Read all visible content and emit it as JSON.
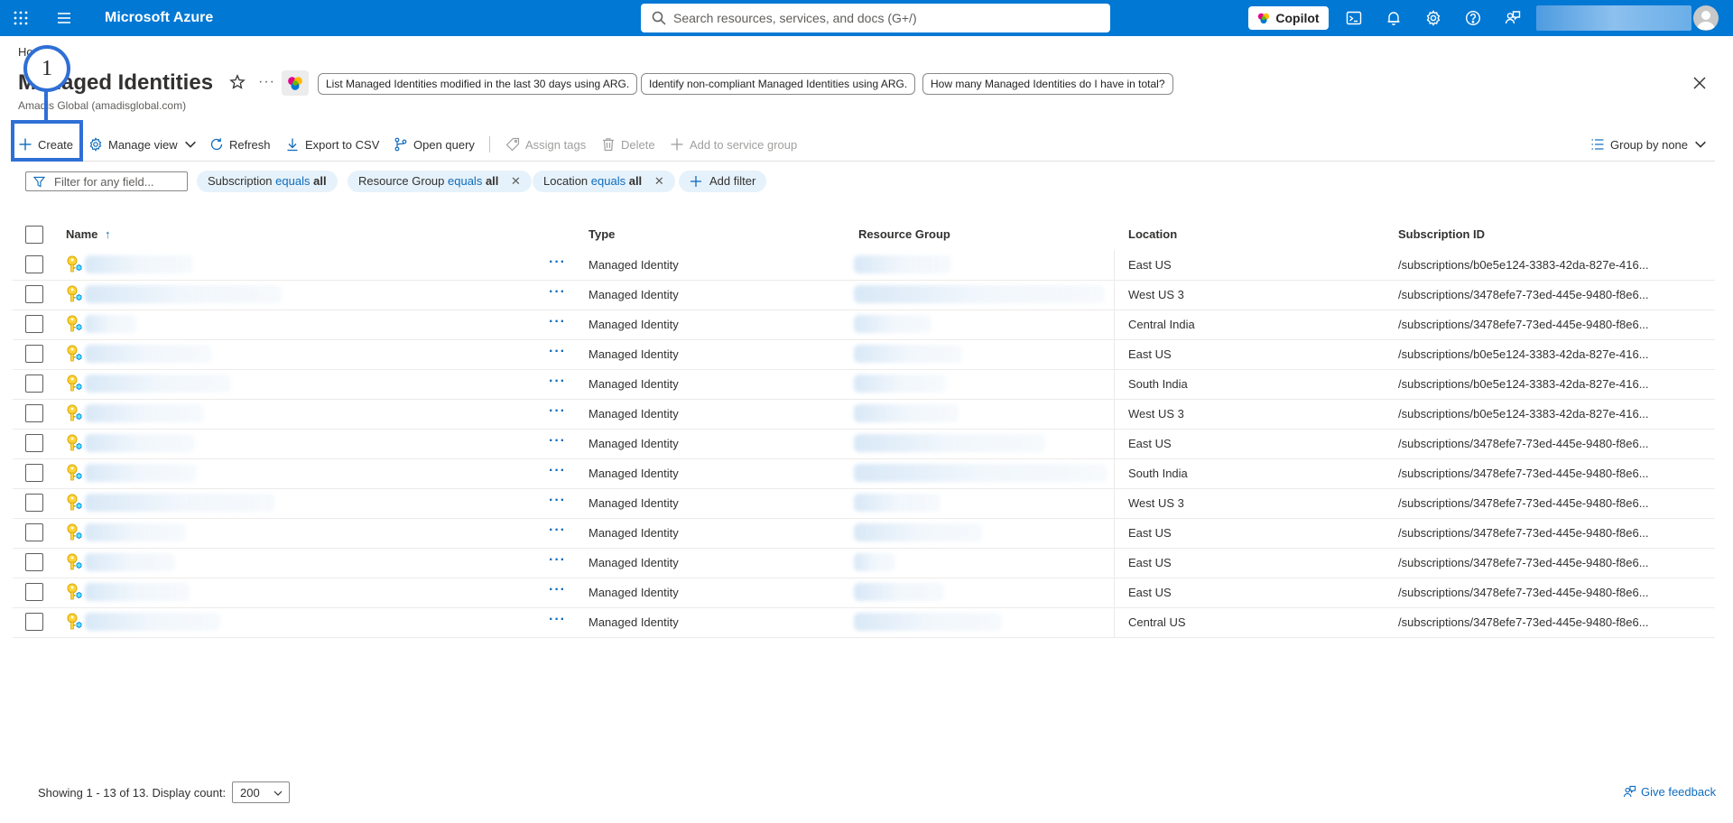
{
  "topbar": {
    "brand": "Microsoft Azure",
    "search_placeholder": "Search resources, services, and docs (G+/)",
    "copilot_label": "Copilot",
    "icons": [
      "waffle-icon",
      "menu-icon",
      "search-icon",
      "terminal-icon",
      "bell-icon",
      "gear-icon",
      "help-icon",
      "feedback-icon",
      "avatar"
    ]
  },
  "header": {
    "breadcrumb": "Ho",
    "title": "Managed Identities",
    "subtitle": "Amadis Global (amadisglobal.com)",
    "suggestions": [
      "List Managed Identities modified in the last 30 days using ARG.",
      "Identify non-compliant Managed Identities using ARG.",
      "How many Managed Identities do I have in total?"
    ]
  },
  "annotation": {
    "step": "1"
  },
  "toolbar": {
    "create": "Create",
    "manage_view": "Manage view",
    "refresh": "Refresh",
    "export_csv": "Export to CSV",
    "open_query": "Open query",
    "assign_tags": "Assign tags",
    "delete": "Delete",
    "add_service_group": "Add to service group",
    "group_by": "Group by none"
  },
  "filters": {
    "placeholder": "Filter for any field...",
    "pills": [
      {
        "field": "Subscription",
        "op": "equals",
        "value": "all"
      },
      {
        "field": "Resource Group",
        "op": "equals",
        "value": "all"
      },
      {
        "field": "Location",
        "op": "equals",
        "value": "all"
      }
    ],
    "add_filter": "Add filter"
  },
  "table": {
    "columns": {
      "name": "Name",
      "sort_indicator": "↑",
      "type": "Type",
      "resource_group": "Resource Group",
      "location": "Location",
      "subscription": "Subscription ID"
    },
    "rows": [
      {
        "type": "Managed Identity",
        "location": "East US",
        "subscription": "/subscriptions/b0e5e124-3383-42da-827e-416..."
      },
      {
        "type": "Managed Identity",
        "location": "West US 3",
        "subscription": "/subscriptions/3478efe7-73ed-445e-9480-f8e6..."
      },
      {
        "type": "Managed Identity",
        "location": "Central India",
        "subscription": "/subscriptions/3478efe7-73ed-445e-9480-f8e6..."
      },
      {
        "type": "Managed Identity",
        "location": "East US",
        "subscription": "/subscriptions/b0e5e124-3383-42da-827e-416..."
      },
      {
        "type": "Managed Identity",
        "location": "South India",
        "subscription": "/subscriptions/b0e5e124-3383-42da-827e-416..."
      },
      {
        "type": "Managed Identity",
        "location": "West US 3",
        "subscription": "/subscriptions/b0e5e124-3383-42da-827e-416..."
      },
      {
        "type": "Managed Identity",
        "location": "East US",
        "subscription": "/subscriptions/3478efe7-73ed-445e-9480-f8e6..."
      },
      {
        "type": "Managed Identity",
        "location": "South India",
        "subscription": "/subscriptions/3478efe7-73ed-445e-9480-f8e6..."
      },
      {
        "type": "Managed Identity",
        "location": "West US 3",
        "subscription": "/subscriptions/3478efe7-73ed-445e-9480-f8e6..."
      },
      {
        "type": "Managed Identity",
        "location": "East US",
        "subscription": "/subscriptions/3478efe7-73ed-445e-9480-f8e6..."
      },
      {
        "type": "Managed Identity",
        "location": "East US",
        "subscription": "/subscriptions/3478efe7-73ed-445e-9480-f8e6..."
      },
      {
        "type": "Managed Identity",
        "location": "East US",
        "subscription": "/subscriptions/3478efe7-73ed-445e-9480-f8e6..."
      },
      {
        "type": "Managed Identity",
        "location": "Central US",
        "subscription": "/subscriptions/3478efe7-73ed-445e-9480-f8e6..."
      }
    ]
  },
  "footer": {
    "showing": "Showing 1 - 13 of 13. Display count:",
    "display_count": "200",
    "give_feedback": "Give feedback"
  },
  "colors": {
    "brand": "#0078d4",
    "link": "#0f6cbd",
    "annotation": "#2f6fd6"
  }
}
